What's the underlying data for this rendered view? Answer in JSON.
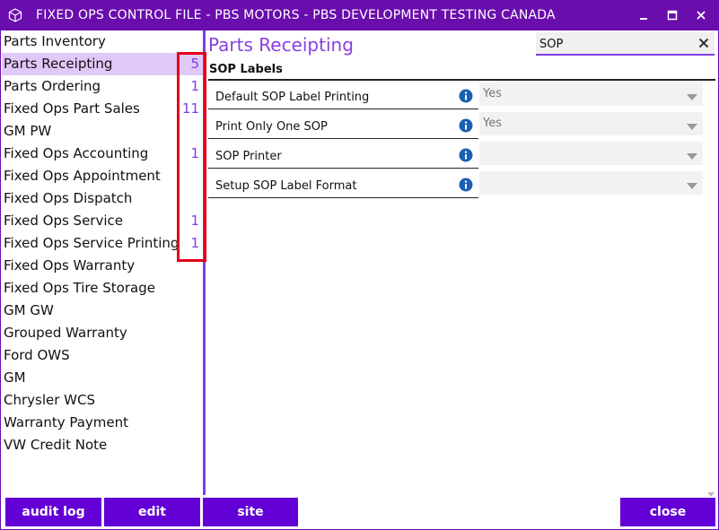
{
  "window": {
    "title": "FIXED OPS CONTROL FILE - PBS MOTORS - PBS DEVELOPMENT TESTING CANADA",
    "icons": {
      "app": "cube-icon",
      "minimize": "minimize-icon",
      "maximize": "maximize-icon",
      "close": "close-icon"
    },
    "accent_color": "#6a0dad"
  },
  "sidebar": {
    "items": [
      {
        "label": "Parts Inventory",
        "count": ""
      },
      {
        "label": "Parts Receipting",
        "count": "5"
      },
      {
        "label": "Parts Ordering",
        "count": "1"
      },
      {
        "label": "Fixed Ops Part Sales",
        "count": "11"
      },
      {
        "label": "GM PW",
        "count": ""
      },
      {
        "label": "Fixed Ops Accounting",
        "count": "1"
      },
      {
        "label": "Fixed Ops Appointment",
        "count": ""
      },
      {
        "label": "Fixed Ops Dispatch",
        "count": ""
      },
      {
        "label": "Fixed Ops Service",
        "count": "1"
      },
      {
        "label": "Fixed Ops Service Printing",
        "count": "1"
      },
      {
        "label": "Fixed Ops Warranty",
        "count": ""
      },
      {
        "label": "Fixed Ops Tire Storage",
        "count": ""
      },
      {
        "label": "GM GW",
        "count": ""
      },
      {
        "label": "Grouped Warranty",
        "count": ""
      },
      {
        "label": "Ford OWS",
        "count": ""
      },
      {
        "label": "GM",
        "count": ""
      },
      {
        "label": "Chrysler WCS",
        "count": ""
      },
      {
        "label": "Warranty Payment",
        "count": ""
      },
      {
        "label": "VW Credit Note",
        "count": ""
      }
    ],
    "selected_label": "Parts Receipting",
    "highlight_color": "#e3001b"
  },
  "main": {
    "title": "Parts Receipting",
    "search": {
      "value": "SOP",
      "placeholder": ""
    },
    "section": "SOP Labels",
    "settings": [
      {
        "label": "Default SOP Label Printing",
        "value": "Yes"
      },
      {
        "label": "Print Only One SOP",
        "value": "Yes"
      },
      {
        "label": "SOP Printer",
        "value": ""
      },
      {
        "label": "Setup SOP Label Format",
        "value": ""
      }
    ]
  },
  "footer": {
    "audit_log": "audit log",
    "edit": "edit",
    "site": "site",
    "close": "close"
  }
}
